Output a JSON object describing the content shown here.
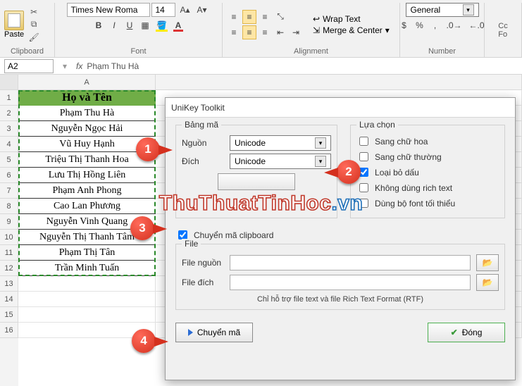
{
  "ribbon": {
    "paste_label": "Paste",
    "font_name": "Times New Roma",
    "font_size": "14",
    "wrap_text": "Wrap Text",
    "merge_center": "Merge & Center",
    "number_format": "General",
    "cond_fmt": "Cc\nFo",
    "groups": {
      "clipboard": "Clipboard",
      "font": "Font",
      "alignment": "Alignment",
      "number": "Number"
    }
  },
  "formula_bar": {
    "name_box": "A2",
    "fx": "fx",
    "value": "Phạm Thu Hà"
  },
  "sheet": {
    "col_header": "A",
    "row_nums": [
      "1",
      "2",
      "3",
      "4",
      "5",
      "6",
      "7",
      "8",
      "9",
      "10",
      "11",
      "12",
      "13",
      "14",
      "15",
      "16"
    ],
    "header": "Họ và Tên",
    "names": [
      "Phạm Thu Hà",
      "Nguyễn Ngọc Hải",
      "Vũ Huy Hạnh",
      "Triệu Thị Thanh Hoa",
      "Lưu Thị Hồng Liên",
      "Phạm Anh Phong",
      "Cao Lan Phương",
      "Nguyễn Vinh Quang",
      "Nguyễn Thị Thanh Tâm",
      "Phạm Thị Tân",
      "Trần Minh Tuấn"
    ]
  },
  "dialog": {
    "title": "UniKey Toolkit",
    "bang_ma": "Bảng mã",
    "nguon": "Nguồn",
    "nguon_val": "Unicode",
    "dich": "Đích",
    "dich_val": "Unicode",
    "mid_button": "",
    "lua_chon": "Lựa chọn",
    "ck_hoa": "Sang chữ hoa",
    "ck_thuong": "Sang chữ thường",
    "ck_bodau": "Loại bỏ dấu",
    "ck_rich": "Không dùng rich text",
    "ck_fontmin": "Dùng bộ font tối thiểu",
    "ck_clip": "Chuyển mã clipboard",
    "file": "File",
    "file_nguon": "File nguồn",
    "file_dich": "File đích",
    "hint": "Chỉ hỗ trợ file text và file Rich Text Format (RTF)",
    "btn_convert": "Chuyển mã",
    "btn_close": "Đóng",
    "checked": {
      "bodau": true,
      "clip": true
    }
  },
  "callouts": {
    "c1": "1",
    "c2": "2",
    "c3": "3",
    "c4": "4"
  },
  "watermark": {
    "a": "ThuThuatTinHoc",
    "b": ".vn"
  }
}
